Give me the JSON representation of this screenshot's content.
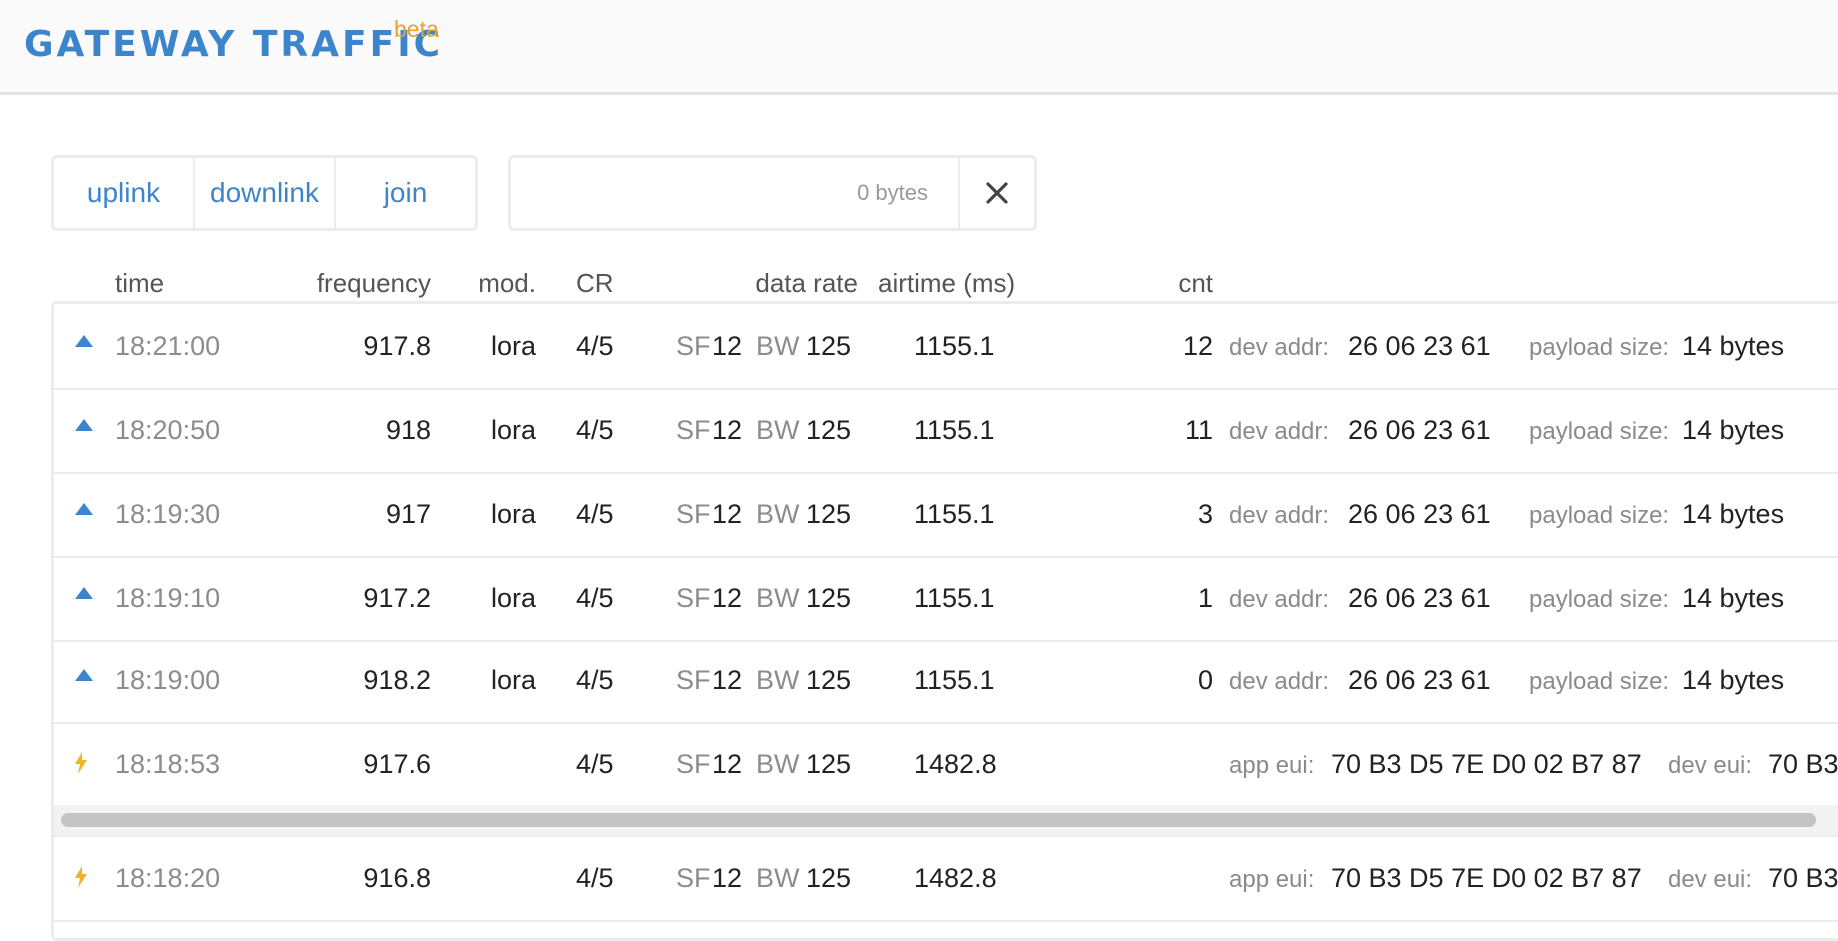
{
  "header": {
    "title": "GATEWAY TRAFFIC",
    "badge": "beta"
  },
  "filters": [
    "uplink",
    "downlink",
    "join"
  ],
  "search": {
    "value": "",
    "byte_count": "0 bytes"
  },
  "columns": [
    "time",
    "frequency",
    "mod.",
    "CR",
    "data rate",
    "airtime (ms)",
    "cnt"
  ],
  "labels": {
    "sf": "SF",
    "bw": "BW",
    "dev_addr": "dev addr:",
    "payload_size": "payload size:",
    "app_eui": "app eui:",
    "dev_eui": "dev eui:"
  },
  "rows": [
    {
      "type": "uplink",
      "time": "18:21:00",
      "frequency": "917.8",
      "mod": "lora",
      "cr": "4/5",
      "sf": "12",
      "bw": "125",
      "airtime": "1155.1",
      "cnt": "12",
      "dev_addr": "26 06 23 61",
      "payload_size": "14 bytes"
    },
    {
      "type": "uplink",
      "time": "18:20:50",
      "frequency": "918",
      "mod": "lora",
      "cr": "4/5",
      "sf": "12",
      "bw": "125",
      "airtime": "1155.1",
      "cnt": "11",
      "dev_addr": "26 06 23 61",
      "payload_size": "14 bytes"
    },
    {
      "type": "uplink",
      "time": "18:19:30",
      "frequency": "917",
      "mod": "lora",
      "cr": "4/5",
      "sf": "12",
      "bw": "125",
      "airtime": "1155.1",
      "cnt": "3",
      "dev_addr": "26 06 23 61",
      "payload_size": "14 bytes"
    },
    {
      "type": "uplink",
      "time": "18:19:10",
      "frequency": "917.2",
      "mod": "lora",
      "cr": "4/5",
      "sf": "12",
      "bw": "125",
      "airtime": "1155.1",
      "cnt": "1",
      "dev_addr": "26 06 23 61",
      "payload_size": "14 bytes"
    },
    {
      "type": "uplink",
      "time": "18:19:00",
      "frequency": "918.2",
      "mod": "lora",
      "cr": "4/5",
      "sf": "12",
      "bw": "125",
      "airtime": "1155.1",
      "cnt": "0",
      "dev_addr": "26 06 23 61",
      "payload_size": "14 bytes"
    },
    {
      "type": "join",
      "time": "18:18:53",
      "frequency": "917.6",
      "mod": "",
      "cr": "4/5",
      "sf": "12",
      "bw": "125",
      "airtime": "1482.8",
      "cnt": "",
      "app_eui": "70 B3 D5 7E D0 02 B7 87",
      "dev_eui": "70 B3"
    },
    {
      "type": "join",
      "time": "18:18:20",
      "frequency": "916.8",
      "mod": "",
      "cr": "4/5",
      "sf": "12",
      "bw": "125",
      "airtime": "1482.8",
      "cnt": "",
      "app_eui": "70 B3 D5 7E D0 02 B7 87",
      "dev_eui": "70 B3"
    }
  ],
  "colors": {
    "accent": "#3c85cd",
    "badge": "#e4a230",
    "join_icon": "#f0b429"
  },
  "icons": {
    "uplink": "triangle-up-icon",
    "join": "lightning-icon",
    "clear": "close-icon"
  }
}
